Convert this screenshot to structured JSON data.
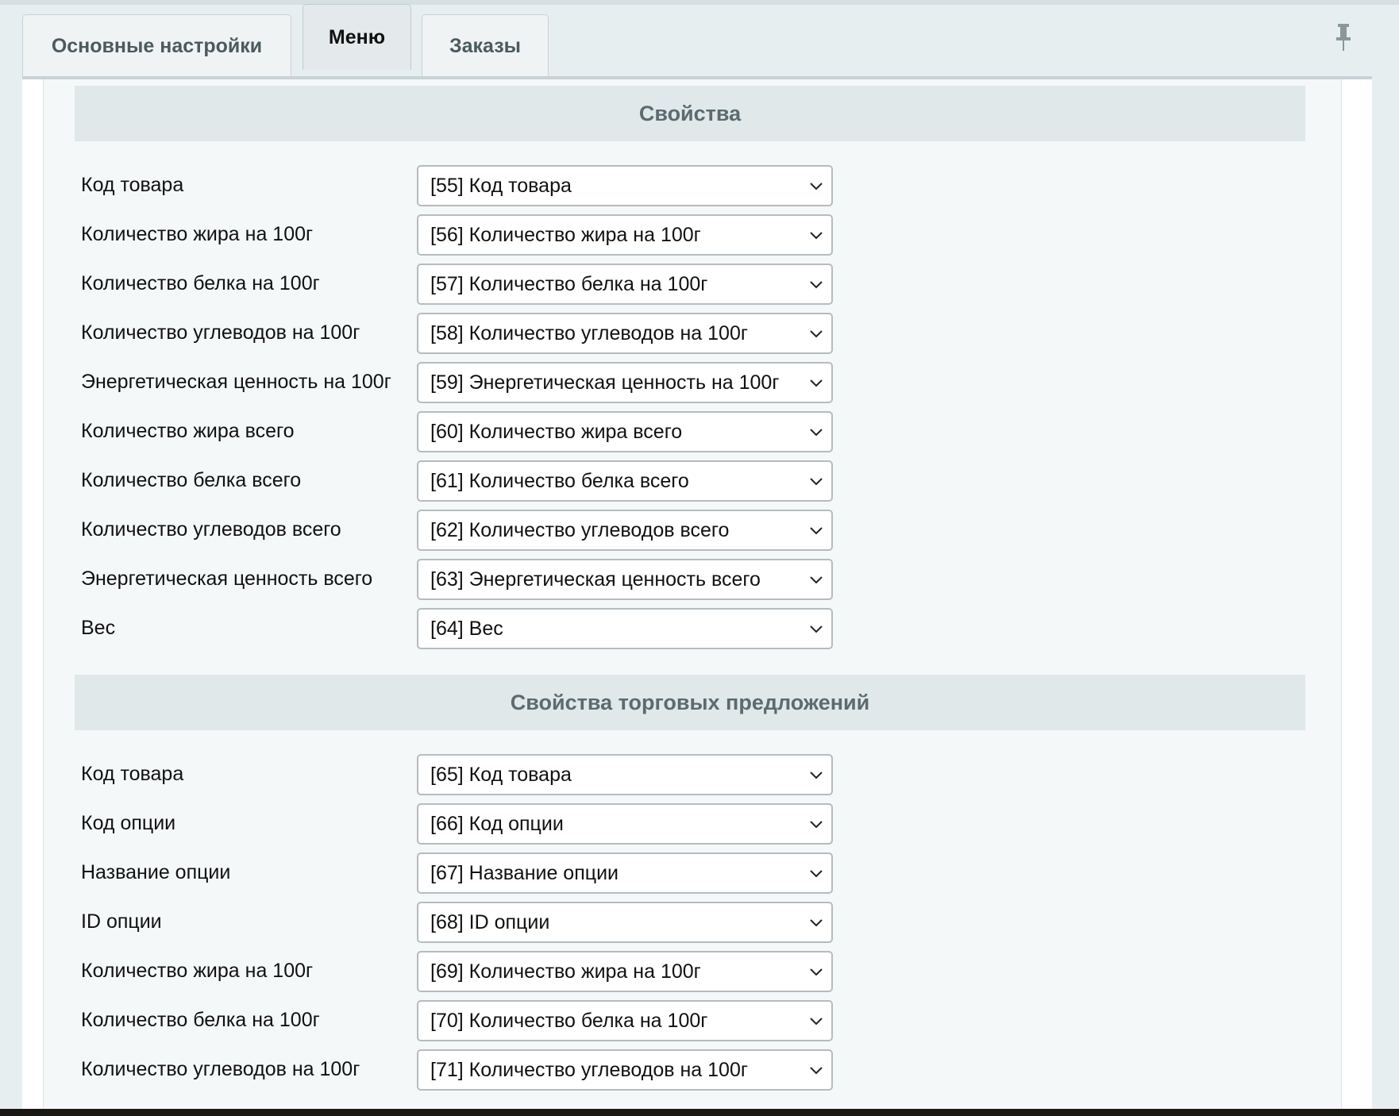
{
  "tabs": [
    {
      "label": "Основные настройки"
    },
    {
      "label": "Меню"
    },
    {
      "label": "Заказы"
    }
  ],
  "sections": [
    {
      "title": "Свойства",
      "rows": [
        {
          "label": "Код товара",
          "value": "[55] Код товара"
        },
        {
          "label": "Количество жира на 100г",
          "value": "[56] Количество жира на 100г"
        },
        {
          "label": "Количество белка на 100г",
          "value": "[57] Количество белка на 100г"
        },
        {
          "label": "Количество углеводов на 100г",
          "value": "[58] Количество углеводов на 100г"
        },
        {
          "label": "Энергетическая ценность на 100г",
          "value": "[59] Энергетическая ценность на 100г"
        },
        {
          "label": "Количество жира всего",
          "value": "[60] Количество жира всего"
        },
        {
          "label": "Количество белка всего",
          "value": "[61] Количество белка всего"
        },
        {
          "label": "Количество углеводов всего",
          "value": "[62] Количество углеводов всего"
        },
        {
          "label": "Энергетическая ценность всего",
          "value": "[63] Энергетическая ценность всего"
        },
        {
          "label": "Вес",
          "value": "[64] Вес"
        }
      ]
    },
    {
      "title": "Свойства торговых предложений",
      "rows": [
        {
          "label": "Код товара",
          "value": "[65] Код товара"
        },
        {
          "label": "Код опции",
          "value": "[66] Код опции"
        },
        {
          "label": "Название опции",
          "value": "[67] Название опции"
        },
        {
          "label": "ID опции",
          "value": "[68] ID опции"
        },
        {
          "label": "Количество жира на 100г",
          "value": "[69] Количество жира на 100г"
        },
        {
          "label": "Количество белка на 100г",
          "value": "[70] Количество белка на 100г"
        },
        {
          "label": "Количество углеводов на 100г",
          "value": "[71] Количество углеводов на 100г"
        }
      ]
    }
  ]
}
